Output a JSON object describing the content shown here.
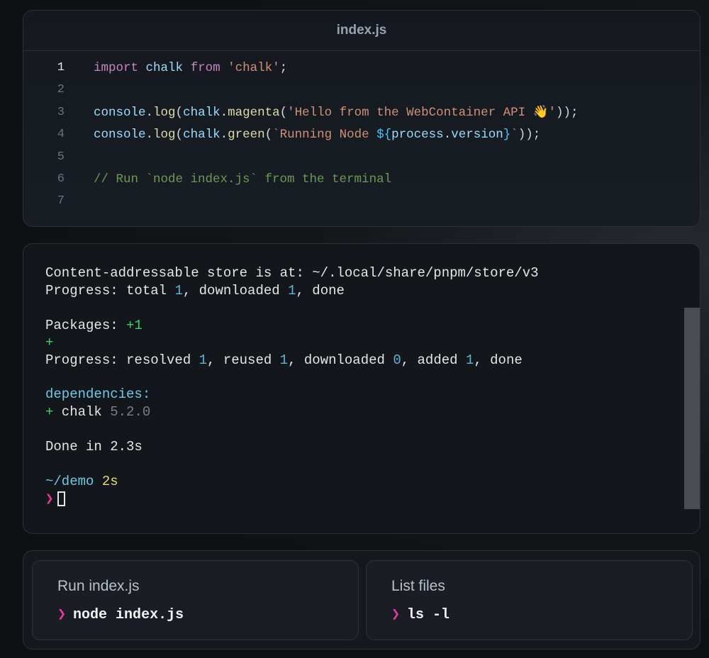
{
  "editor": {
    "filename": "index.js",
    "lines": [
      {
        "n": "1",
        "tokens": [
          [
            "kw",
            "import"
          ],
          [
            "pl",
            " "
          ],
          [
            "id",
            "chalk"
          ],
          [
            "pl",
            " "
          ],
          [
            "kw",
            "from"
          ],
          [
            "pl",
            " "
          ],
          [
            "str",
            "'chalk'"
          ],
          [
            "pl",
            ";"
          ]
        ]
      },
      {
        "n": "2",
        "tokens": []
      },
      {
        "n": "3",
        "tokens": [
          [
            "id",
            "console"
          ],
          [
            "pl",
            "."
          ],
          [
            "fn",
            "log"
          ],
          [
            "pl",
            "("
          ],
          [
            "id",
            "chalk"
          ],
          [
            "pl",
            "."
          ],
          [
            "fn",
            "magenta"
          ],
          [
            "pl",
            "("
          ],
          [
            "str",
            "'Hello from the WebContainer API 👋'"
          ],
          [
            "pl",
            "));"
          ]
        ]
      },
      {
        "n": "4",
        "tokens": [
          [
            "id",
            "console"
          ],
          [
            "pl",
            "."
          ],
          [
            "fn",
            "log"
          ],
          [
            "pl",
            "("
          ],
          [
            "id",
            "chalk"
          ],
          [
            "pl",
            "."
          ],
          [
            "fn",
            "green"
          ],
          [
            "pl",
            "("
          ],
          [
            "str",
            "`Running Node "
          ],
          [
            "tvar",
            "${"
          ],
          [
            "id",
            "process"
          ],
          [
            "pl",
            "."
          ],
          [
            "id",
            "version"
          ],
          [
            "tvar",
            "}"
          ],
          [
            "str",
            "`"
          ],
          [
            "pl",
            "));"
          ]
        ]
      },
      {
        "n": "5",
        "tokens": []
      },
      {
        "n": "6",
        "tokens": [
          [
            "cm",
            "// Run `node index.js` from the terminal"
          ]
        ]
      },
      {
        "n": "7",
        "tokens": []
      }
    ]
  },
  "terminal": {
    "store_line": "Content-addressable store is at: ~/.local/share/pnpm/store/v3",
    "progress1": {
      "prefix": "Progress: total ",
      "total": "1",
      "mid": ", downloaded ",
      "downloaded": "1",
      "suffix": ", done"
    },
    "packages": {
      "label": "Packages: ",
      "count": "+1"
    },
    "plus_bar": "+",
    "progress2": {
      "prefix": "Progress: resolved ",
      "resolved": "1",
      "sep1": ", reused ",
      "reused": "1",
      "sep2": ", downloaded ",
      "downloaded": "0",
      "sep3": ", added ",
      "added": "1",
      "suffix": ", done"
    },
    "deps_header": "dependencies:",
    "dep": {
      "plus": "+",
      "name": " chalk ",
      "version": "5.2.0"
    },
    "done_line": "Done in 2.3s",
    "prompt": {
      "cwd": "~/demo",
      "duration": "2s",
      "symbol": "❯"
    }
  },
  "actions": [
    {
      "title": "Run index.js",
      "symbol": "❯",
      "command": "node index.js"
    },
    {
      "title": "List files",
      "symbol": "❯",
      "command": "ls -l"
    }
  ]
}
